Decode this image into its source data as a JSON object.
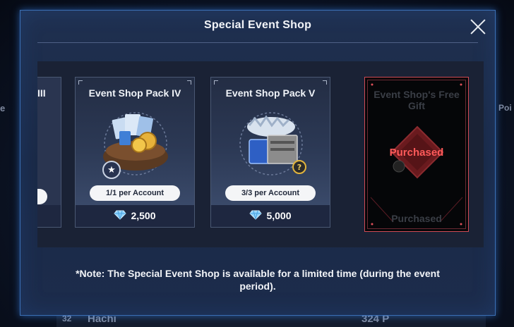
{
  "shop": {
    "title": "Special Event Shop",
    "partial_card_title": "III",
    "cards": [
      {
        "title": "Event Shop Pack IV",
        "limit": "1/1 per Account",
        "price": "2,500"
      },
      {
        "title": "Event Shop Pack V",
        "limit": "3/3 per Account",
        "price": "5,000"
      }
    ],
    "free_gift": {
      "title": "Event Shop's Free Gift",
      "status": "Purchased",
      "footer": "Purchased"
    },
    "note": "*Note: The Special Event Shop is available for a limited time (during the event period)."
  },
  "background": {
    "left_text": "e",
    "right_text": "Poi",
    "player_rank": "32",
    "player_name": "Hachi",
    "player_points": "324 P"
  },
  "icons": [
    "close-icon",
    "gem-icon",
    "star-icon",
    "question-icon"
  ],
  "colors": {
    "accent_border": "#3b6fb4",
    "purchased_red": "#ff5a5a",
    "card_bg": "#2a3550"
  }
}
